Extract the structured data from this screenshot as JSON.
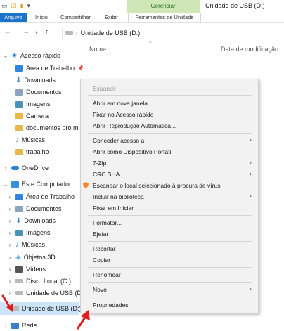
{
  "ribbon": {
    "context_group": "Gerenciar",
    "window_title": "Unidade de USB (D:)",
    "tabs": [
      "Arquivo",
      "Início",
      "Compartilhar",
      "Exibir",
      "Ferramentas de Unidade"
    ]
  },
  "address": {
    "path": "Unidade de USB (D:)"
  },
  "columns": {
    "name": "Nome",
    "date": "Data de modificação"
  },
  "nav": {
    "quick_access": "Acesso rápido",
    "quick_items": [
      "Área de Trabalho",
      "Downloads",
      "Documentos",
      "Imagens",
      "Camera",
      "documentos pro m",
      "Músicas",
      "trabalho"
    ],
    "onedrive": "OneDrive",
    "this_pc": "Este Computador",
    "pc_items": [
      "Área de Trabalho",
      "Documentos",
      "Downloads",
      "Imagens",
      "Músicas",
      "Objetos 3D",
      "Vídeos",
      "Disco Local (C:)",
      "Unidade de USB (D:"
    ],
    "selected": "Unidade de USB (D:)",
    "network": "Rede"
  },
  "context_menu": {
    "expand": "Expandir",
    "open_new_window": "Abrir em nova janela",
    "pin_quick_access": "Fixar no Acesso rápido",
    "autoplay": "Abrir Reprodução Automática...",
    "give_access": "Conceder acesso a",
    "open_portable": "Abrir como Dispositivo Portátil",
    "seven_zip": "7-Zip",
    "crc_sha": "CRC SHA",
    "scan": "Escanear o local selecionado à procura de vírus",
    "include_library": "Incluir na biblioteca",
    "pin_start": "Fixar em Iniciar",
    "format": "Formatar...",
    "eject": "Ejetar",
    "cut": "Recortar",
    "copy": "Copiar",
    "rename": "Renomear",
    "new": "Novo",
    "properties": "Propriedades"
  },
  "colors": {
    "accent": "#1a73c8",
    "manage_tab": "#cfe6b6",
    "selection": "#cce4f7",
    "annotation": "#e21b1b"
  }
}
